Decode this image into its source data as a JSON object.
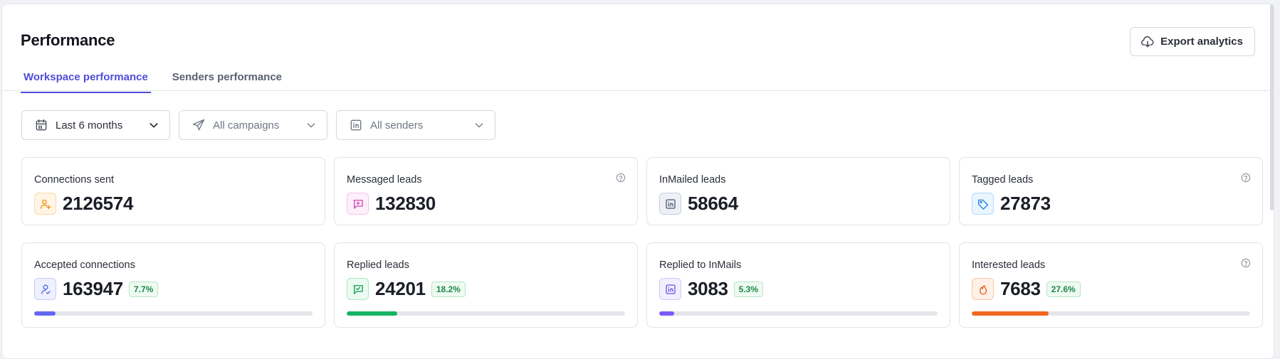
{
  "header": {
    "title": "Performance",
    "export_label": "Export analytics",
    "export_icon": "cloud-download-icon"
  },
  "tabs": [
    {
      "label": "Workspace performance",
      "active": true
    },
    {
      "label": "Senders performance",
      "active": false
    }
  ],
  "filters": {
    "period": {
      "value": "Last 6 months",
      "icon": "calendar-icon"
    },
    "campaigns": {
      "value": "All campaigns",
      "icon": "send-icon"
    },
    "senders": {
      "value": "All senders",
      "icon": "linkedin-icon"
    }
  },
  "cards": {
    "connections_sent": {
      "title": "Connections sent",
      "value": "2126574",
      "icon": "user-plus-icon"
    },
    "messaged_leads": {
      "title": "Messaged leads",
      "value": "132830",
      "icon": "message-plus-icon"
    },
    "inmailed_leads": {
      "title": "InMailed leads",
      "value": "58664",
      "icon": "linkedin-icon"
    },
    "tagged_leads": {
      "title": "Tagged leads",
      "value": "27873",
      "icon": "tag-icon"
    },
    "accepted_connections": {
      "title": "Accepted connections",
      "value": "163947",
      "percent": "7.7%",
      "progress": 0.077,
      "icon": "user-icon"
    },
    "replied_leads": {
      "title": "Replied leads",
      "value": "24201",
      "percent": "18.2%",
      "progress": 0.182,
      "icon": "message-check-icon"
    },
    "replied_inmails": {
      "title": "Replied to InMails",
      "value": "3083",
      "percent": "5.3%",
      "progress": 0.053,
      "icon": "linkedin-icon"
    },
    "interested_leads": {
      "title": "Interested leads",
      "value": "7683",
      "percent": "27.6%",
      "progress": 0.276,
      "icon": "flame-icon"
    }
  },
  "colors": {
    "accent": "#4f4ed8",
    "accepted_bar": "#6366f1",
    "replied_bar": "#16b364",
    "inmail_bar": "#7a5af8",
    "interested_bar": "#ef6820"
  }
}
